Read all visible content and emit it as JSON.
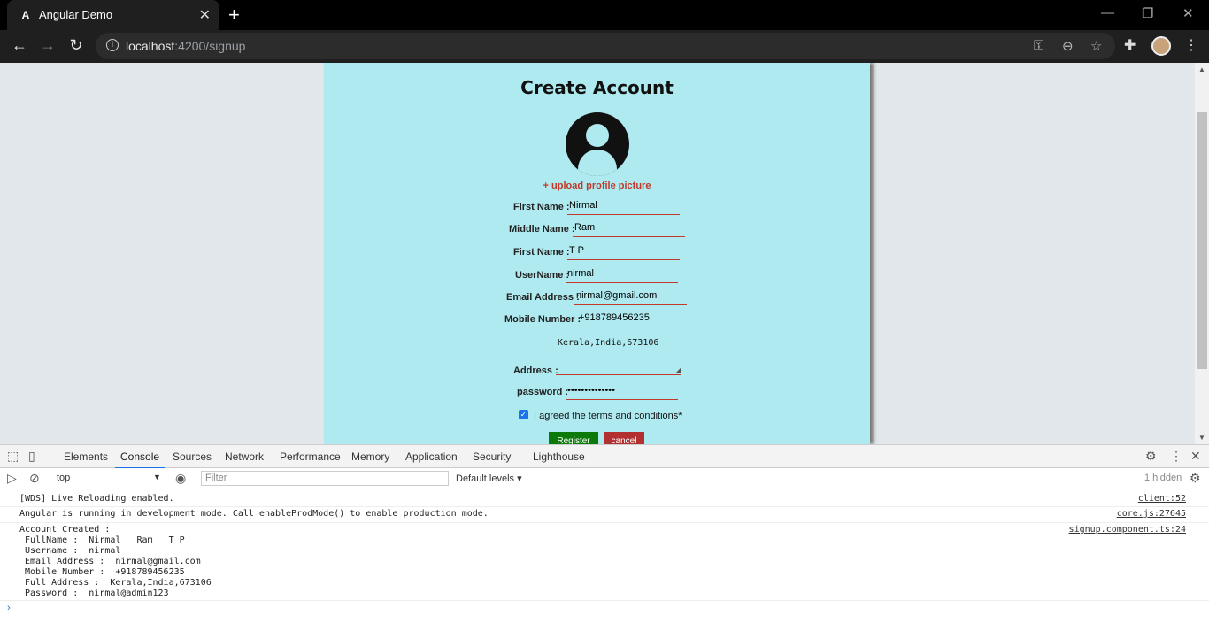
{
  "browser": {
    "tab_title": "Angular Demo",
    "url_host": "localhost",
    "url_rest": ":4200/signup"
  },
  "form": {
    "title": "Create Account",
    "upload_label": "+ upload profile picture",
    "fields": [
      {
        "label": "First Name :",
        "value": "Nirmal"
      },
      {
        "label": "Middle Name :",
        "value": "Ram"
      },
      {
        "label": "First Name :",
        "value": "T P"
      },
      {
        "label": "UserName :",
        "value": "nirmal"
      },
      {
        "label": "Email Address :",
        "value": "nirmal@gmail.com"
      },
      {
        "label": "Mobile Number :",
        "value": "+918789456235"
      }
    ],
    "address_text": "Kerala,India,673106",
    "address_label": "Address :",
    "password_label": "password :",
    "password_value": "••••••••••••••",
    "terms_label": "I agreed the terms and conditions*",
    "register_label": "Register",
    "cancel_label": "cancel"
  },
  "devtools": {
    "tabs": [
      "Elements",
      "Console",
      "Sources",
      "Network",
      "Performance",
      "Memory",
      "Application",
      "Security",
      "Lighthouse"
    ],
    "active_tab": "Console",
    "context": "top",
    "filter_placeholder": "Filter",
    "levels": "Default levels ▾",
    "hidden_count": "1 hidden",
    "logs": [
      {
        "message": "[WDS] Live Reloading enabled.",
        "source": "client:52"
      },
      {
        "message": "Angular is running in development mode. Call enableProdMode() to enable production mode.",
        "source": "core.js:27645"
      },
      {
        "message": "Account Created :\n FullName :  Nirmal   Ram   T P\n Username :  nirmal\n Email Address :  nirmal@gmail.com\n Mobile Number :  +918789456235\n Full Address :  Kerala,India,673106\n Password :  nirmal@admin123",
        "source": "signup.component.ts:24"
      }
    ]
  }
}
